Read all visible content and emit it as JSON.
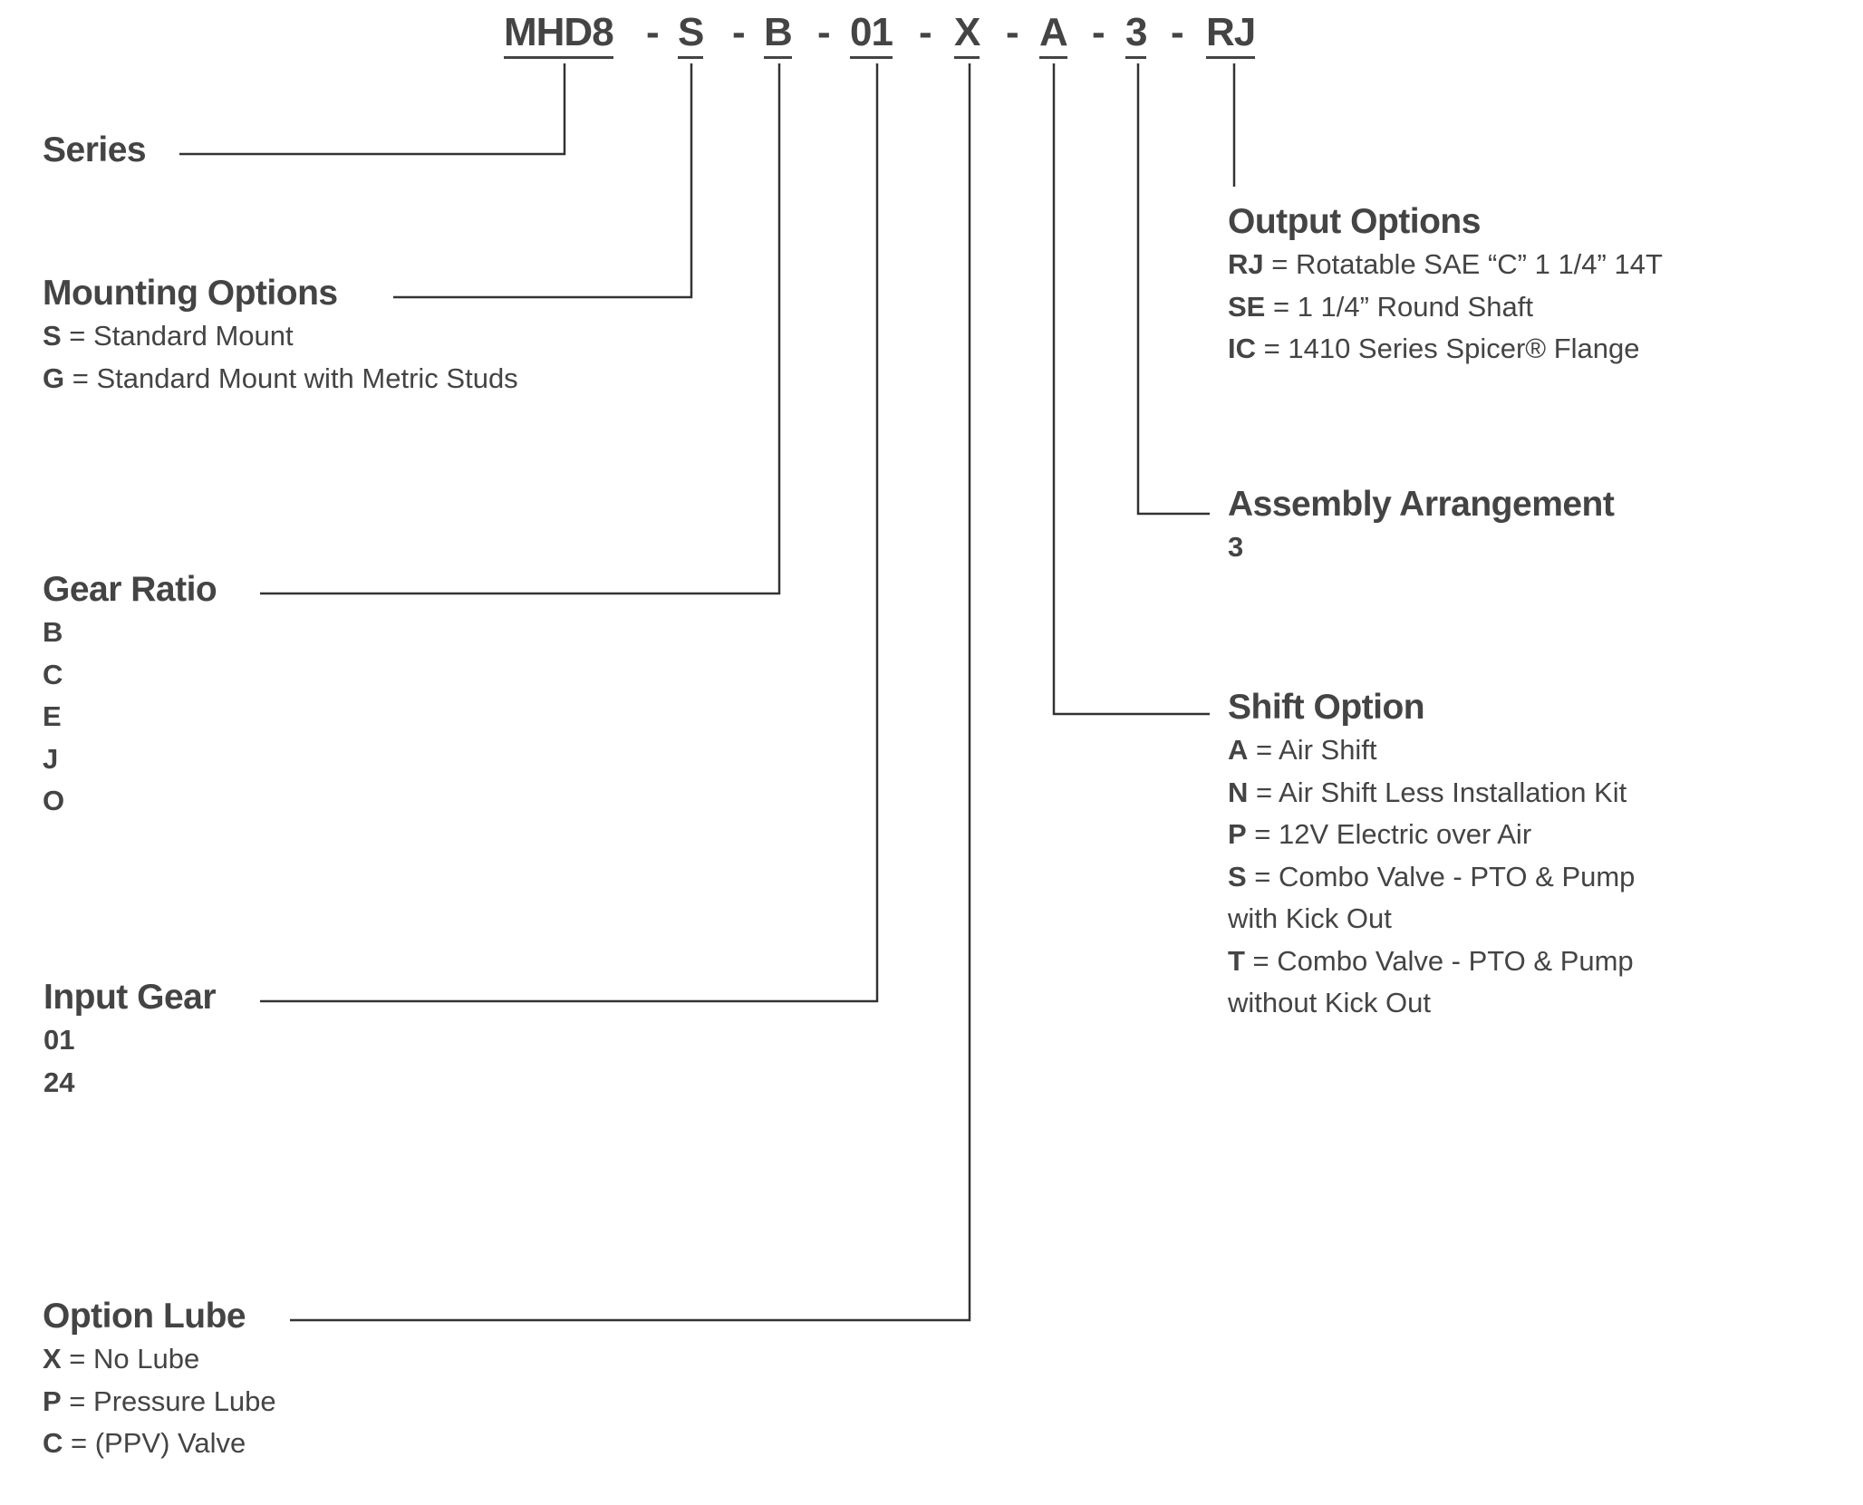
{
  "part_number": {
    "segments": [
      "MHD8",
      "S",
      "B",
      "01",
      "X",
      "A",
      "3",
      "RJ"
    ],
    "separator": "-"
  },
  "sections": {
    "series": {
      "title": "Series",
      "options": []
    },
    "mounting": {
      "title": "Mounting Options",
      "options": [
        {
          "code": "S",
          "eq": " = ",
          "desc": "Standard Mount"
        },
        {
          "code": "G",
          "eq": " = ",
          "desc": "Standard Mount with Metric Studs"
        }
      ]
    },
    "gear_ratio": {
      "title": "Gear Ratio",
      "options": [
        {
          "code": "B"
        },
        {
          "code": "C"
        },
        {
          "code": "E"
        },
        {
          "code": "J"
        },
        {
          "code": "O"
        }
      ]
    },
    "input_gear": {
      "title": "Input Gear",
      "options": [
        {
          "code": "01"
        },
        {
          "code": "24"
        }
      ]
    },
    "option_lube": {
      "title": "Option Lube",
      "options": [
        {
          "code": "X",
          "eq": " = ",
          "desc": "No Lube"
        },
        {
          "code": "P",
          "eq": " = ",
          "desc": "Pressure Lube"
        },
        {
          "code": "C",
          "eq": " = ",
          "desc": "(PPV) Valve"
        }
      ]
    },
    "output": {
      "title": "Output Options",
      "options": [
        {
          "code": "RJ",
          "eq": " = ",
          "desc": "Rotatable SAE “C” 1 1/4” 14T"
        },
        {
          "code": "SE",
          "eq": " = ",
          "desc": "1 1/4” Round Shaft"
        },
        {
          "code": "IC",
          "eq": " = ",
          "desc": "1410 Series Spicer® Flange"
        }
      ]
    },
    "assembly": {
      "title": "Assembly Arrangement",
      "options": [
        {
          "code": "3"
        }
      ]
    },
    "shift": {
      "title": "Shift Option",
      "options": [
        {
          "code": "A",
          "eq": " = ",
          "desc": "Air Shift"
        },
        {
          "code": "N",
          "eq": " = ",
          "desc": "Air Shift Less Installation Kit"
        },
        {
          "code": "P",
          "eq": " = ",
          "desc": "12V Electric over Air"
        },
        {
          "code": "S",
          "eq": " = ",
          "desc": "Combo Valve - PTO & Pump",
          "desc2": "with Kick Out"
        },
        {
          "code": "T",
          "eq": " = ",
          "desc": "Combo Valve - PTO & Pump",
          "desc2": "without Kick Out"
        }
      ]
    }
  },
  "colors": {
    "text": "#444444",
    "line": "#333333"
  }
}
